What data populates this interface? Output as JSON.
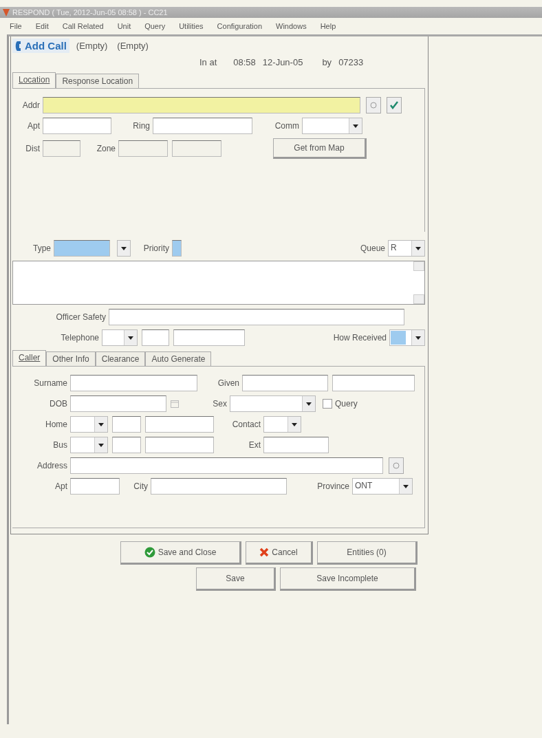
{
  "window": {
    "title": "RESPOND ( Tue, 2012-Jun-05 08:58 ) - CC21"
  },
  "menu": [
    "File",
    "Edit",
    "Call Related",
    "Unit",
    "Query",
    "Utilities",
    "Configuration",
    "Windows",
    "Help"
  ],
  "call_tabs": [
    {
      "label": "Add Call",
      "selected": true
    },
    {
      "label": "(Empty)",
      "selected": false
    },
    {
      "label": "(Empty)",
      "selected": false
    }
  ],
  "timestamp": {
    "in_at_label": "In at",
    "time": "08:58",
    "date": "12-Jun-05",
    "by_label": "by",
    "user": "07233"
  },
  "location_tabs": [
    {
      "label": "Location",
      "selected": true
    },
    {
      "label": "Response Location",
      "selected": false
    }
  ],
  "location": {
    "addr_label": "Addr",
    "apt_label": "Apt",
    "ring_label": "Ring",
    "comm_label": "Comm",
    "dist_label": "Dist",
    "zone_label": "Zone",
    "map_button": "Get from Map"
  },
  "call": {
    "type_label": "Type",
    "priority_label": "Priority",
    "queue_label": "Queue",
    "queue_value": "R",
    "officer_safety_label": "Officer Safety",
    "telephone_label": "Telephone",
    "how_received_label": "How Received"
  },
  "caller_tabs": [
    {
      "label": "Caller",
      "selected": true
    },
    {
      "label": "Other Info",
      "selected": false
    },
    {
      "label": "Clearance",
      "selected": false
    },
    {
      "label": "Auto Generate",
      "selected": false
    }
  ],
  "caller": {
    "surname_label": "Surname",
    "given_label": "Given",
    "dob_label": "DOB",
    "sex_label": "Sex",
    "query": {
      "label": "Query",
      "checked": false
    },
    "home_label": "Home",
    "contact_label": "Contact",
    "bus_label": "Bus",
    "ext_label": "Ext",
    "address_label": "Address",
    "apt_label": "Apt",
    "city_label": "City",
    "province_label": "Province",
    "province_value": "ONT"
  },
  "buttons": [
    [
      {
        "label": "Save and Close",
        "kind": "ok"
      },
      {
        "label": "Cancel",
        "kind": "cancel"
      },
      {
        "label": "Entities (0)",
        "kind": "plain"
      }
    ],
    [
      {
        "label": "Save",
        "kind": "plain"
      },
      {
        "label": "Save Incomplete",
        "kind": "plain"
      }
    ]
  ]
}
